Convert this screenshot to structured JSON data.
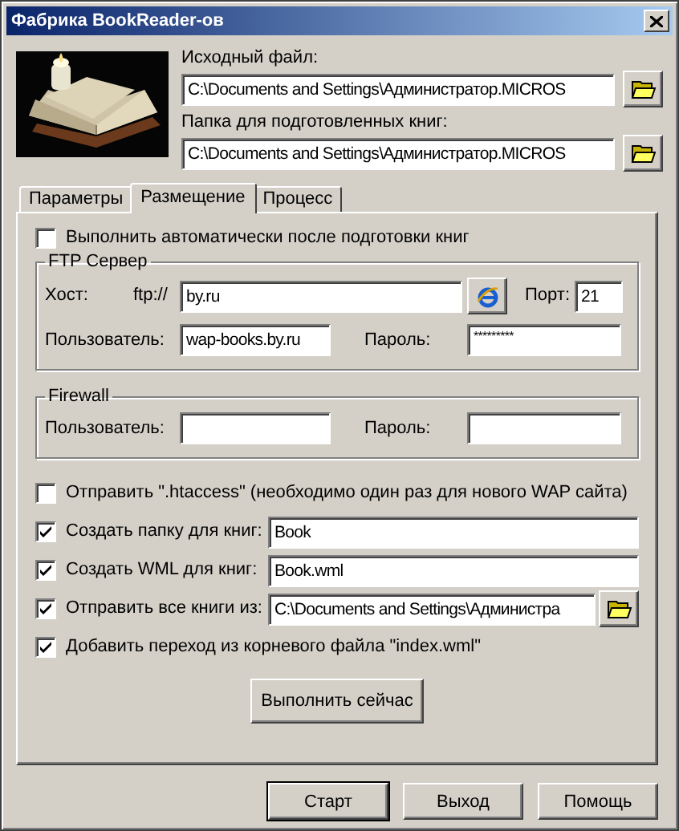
{
  "window": {
    "title": "Фабрика BookReader-ов"
  },
  "source": {
    "label": "Исходный файл:",
    "value": "C:\\Documents and Settings\\Администратор.MICROS"
  },
  "output_folder": {
    "label": "Папка для подготовленных книг:",
    "value": "C:\\Documents and Settings\\Администратор.MICROS"
  },
  "tabs": [
    {
      "label": "Параметры",
      "selected": false
    },
    {
      "label": "Размещение",
      "selected": true
    },
    {
      "label": "Процесс",
      "selected": false
    }
  ],
  "auto_run": {
    "label": "Выполнить автоматически после подготовки книг",
    "checked": false
  },
  "ftp": {
    "title": "FTP Сервер",
    "host_label": "Хост:",
    "prefix": "ftp://",
    "host": "by.ru",
    "port_label": "Порт:",
    "port": "21",
    "user_label": "Пользователь:",
    "user": "wap-books.by.ru",
    "password_label": "Пароль:",
    "password": "*********"
  },
  "firewall": {
    "title": "Firewall",
    "user_label": "Пользователь:",
    "password_label": "Пароль:"
  },
  "options": [
    {
      "kind": "check",
      "label": "Отправить \".htaccess\" (необходимо один раз для нового WAP сайта)",
      "checked": false
    },
    {
      "kind": "field",
      "label": "Создать папку для книг:",
      "checked": true,
      "value": "Book"
    },
    {
      "kind": "field",
      "label": "Создать WML для книг:",
      "checked": true,
      "value": "Book.wml"
    },
    {
      "kind": "path",
      "label": "Отправить все книги из:",
      "checked": true,
      "value": "C:\\Documents and Settings\\Администра"
    },
    {
      "kind": "check",
      "label": "Добавить переход из корневого файла \"index.wml\"",
      "checked": true
    }
  ],
  "run_now": "Выполнить сейчас",
  "buttons": [
    {
      "label": "Старт",
      "default": true
    },
    {
      "label": "Выход",
      "default": false
    },
    {
      "label": "Помощь",
      "default": false
    }
  ]
}
